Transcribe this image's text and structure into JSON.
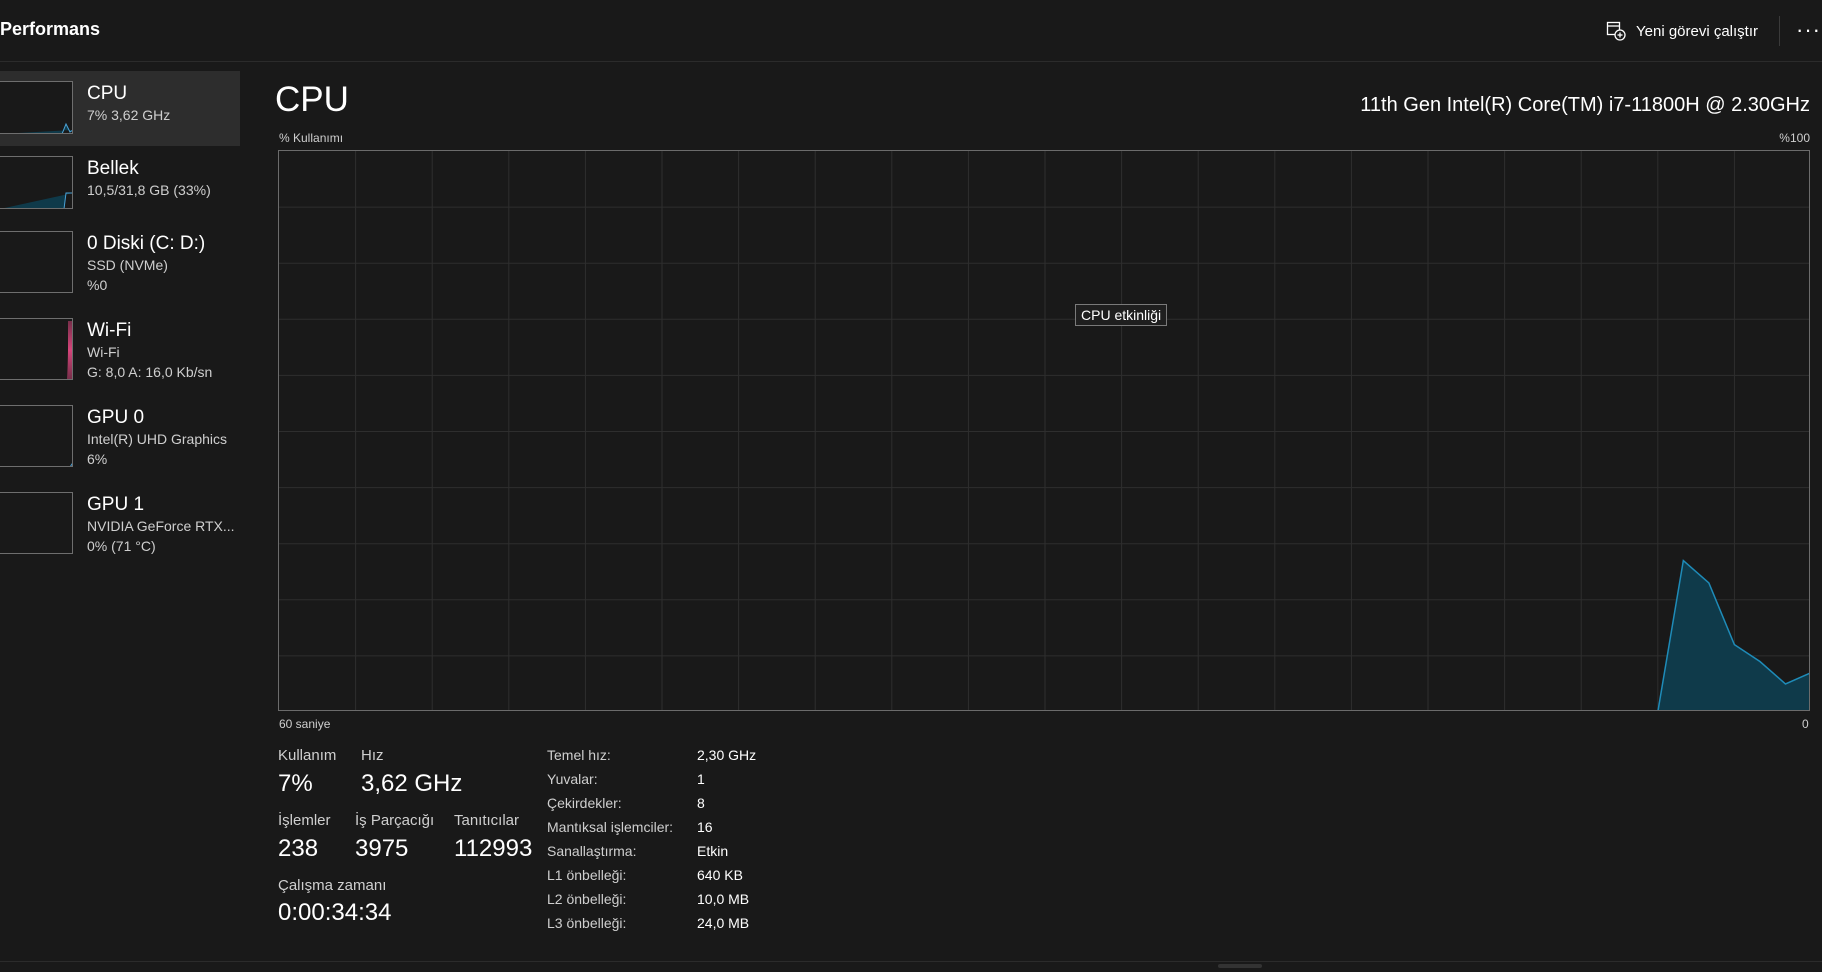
{
  "header": {
    "title": "Performans",
    "run_task_label": "Yeni görevi çalıştır",
    "more_label": "···",
    "run_task_icon": "run-task-icon",
    "more_icon": "more-icon"
  },
  "sidebar": {
    "items": [
      {
        "title": "CPU",
        "line1": "7%  3,62 GHz",
        "line2": "",
        "color": "#4aa3d8",
        "selected": true
      },
      {
        "title": "Bellek",
        "line1": "10,5/31,8 GB (33%)",
        "line2": "",
        "color": "#4aa3d8",
        "selected": false
      },
      {
        "title": "0 Diski (C: D:)",
        "line1": "SSD (NVMe)",
        "line2": "%0",
        "color": "#4caf50",
        "selected": false
      },
      {
        "title": "Wi-Fi",
        "line1": "Wi-Fi",
        "line2": "G: 8,0  A: 16,0 Kb/sn",
        "color": "#d6457b",
        "selected": false
      },
      {
        "title": "GPU 0",
        "line1": "Intel(R) UHD Graphics",
        "line2": "6%",
        "color": "#4aa3d8",
        "selected": false
      },
      {
        "title": "GPU 1",
        "line1": "NVIDIA GeForce RTX...",
        "line2": "0%  (71 °C)",
        "color": "#4aa3d8",
        "selected": false
      }
    ]
  },
  "main": {
    "title": "CPU",
    "processor": "11th Gen Intel(R) Core(TM) i7-11800H @ 2.30GHz",
    "usage_label": "% Kullanımı",
    "max_label": "%100",
    "time_label": "60 saniye",
    "zero_label": "0",
    "tooltip": "CPU etkinliği"
  },
  "stats": {
    "usage_label": "Kullanım",
    "usage_value": "7%",
    "speed_label": "Hız",
    "speed_value": "3,62 GHz",
    "processes_label": "İşlemler",
    "processes_value": "238",
    "threads_label": "İş Parçacığı",
    "threads_value": "3975",
    "handles_label": "Tanıtıcılar",
    "handles_value": "112993",
    "uptime_label": "Çalışma zamanı",
    "uptime_value": "0:00:34:34"
  },
  "specs": [
    {
      "key": "Temel hız:",
      "value": "2,30 GHz"
    },
    {
      "key": "Yuvalar:",
      "value": "1"
    },
    {
      "key": "Çekirdekler:",
      "value": "8"
    },
    {
      "key": "Mantıksal işlemciler:",
      "value": "16"
    },
    {
      "key": "Sanallaştırma:",
      "value": "Etkin"
    },
    {
      "key": "L1 önbelleği:",
      "value": "640 KB"
    },
    {
      "key": "L2 önbelleği:",
      "value": "10,0 MB"
    },
    {
      "key": "L3 önbelleği:",
      "value": "24,0 MB"
    }
  ],
  "chart_data": {
    "type": "area",
    "xlabel": "60 saniye",
    "ylabel": "% Kullanımı",
    "xlim": [
      60,
      0
    ],
    "ylim": [
      0,
      100
    ],
    "grid": true,
    "series": [
      {
        "x": [
          60,
          58,
          56,
          54,
          52,
          50,
          48,
          46,
          44,
          42,
          40,
          38,
          36,
          34,
          32,
          30,
          28,
          26,
          24,
          22,
          20,
          18,
          16,
          14,
          12,
          10,
          8,
          6,
          5,
          4,
          3,
          2,
          1,
          0
        ],
        "values": [
          0,
          0,
          0,
          0,
          0,
          0,
          0,
          0,
          0,
          0,
          0,
          0,
          0,
          0,
          0,
          0,
          0,
          0,
          0,
          0,
          0,
          0,
          0,
          0,
          0,
          0,
          0,
          0,
          27,
          23,
          12,
          9,
          5,
          7
        ]
      }
    ],
    "line_color": "#1e8bb8",
    "fill_color": "#0f3a4a"
  }
}
